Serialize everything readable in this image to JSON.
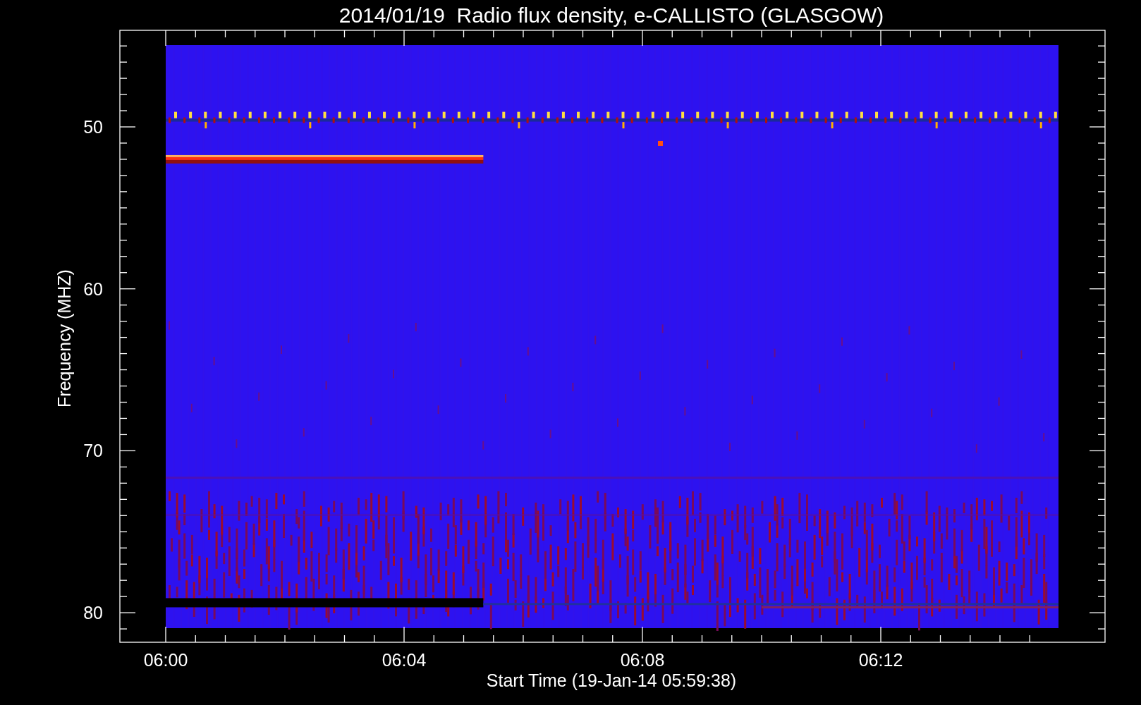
{
  "title": "2014/01/19  Radio flux density, e-CALLISTO (GLASGOW)",
  "y_axis": {
    "label": "Frequency (MHZ)",
    "ticks": [
      "50",
      "60",
      "70",
      "80"
    ]
  },
  "x_axis": {
    "label": "Start Time (19-Jan-14 05:59:38)",
    "ticks": [
      "06:00",
      "06:04",
      "06:08",
      "06:12"
    ]
  }
}
